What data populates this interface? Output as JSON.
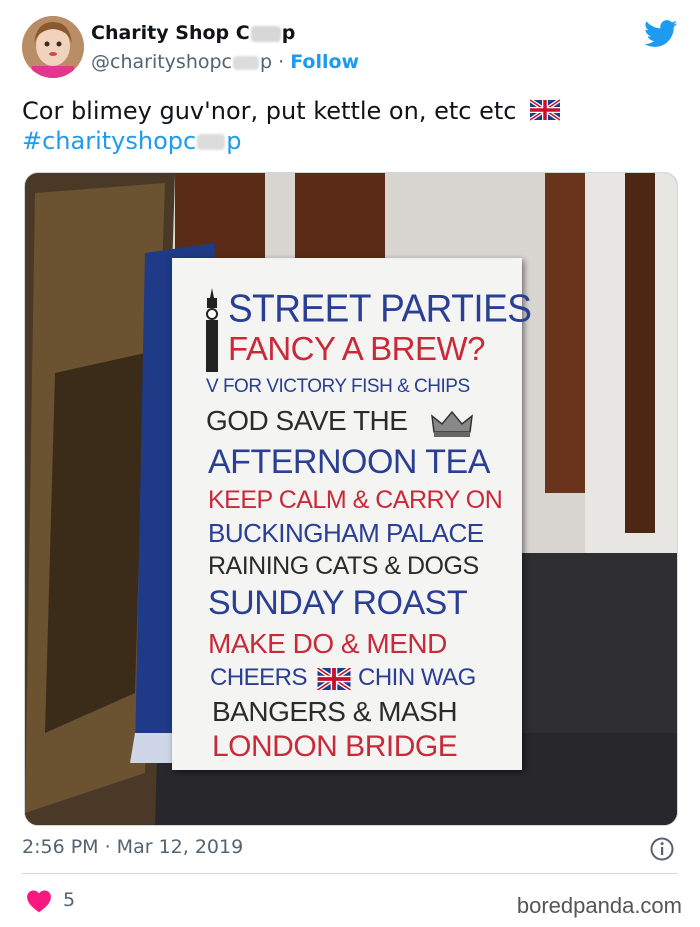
{
  "tweet": {
    "display_name_start": "Charity Shop C",
    "display_name_end": "p",
    "handle_start": "@charityshopc",
    "handle_end": "p",
    "separator": "·",
    "follow_label": "Follow",
    "text": "Cor blimey guv'nor, put kettle on, etc etc",
    "hashtag_start": "#charityshopc",
    "hashtag_end": "p",
    "timestamp": "2:56 PM · Mar 12, 2019",
    "like_count": "5"
  },
  "sign": {
    "lines": [
      "STREET PARTIES",
      "FANCY A BREW?",
      "V FOR VICTORY  FISH & CHIPS",
      "GOD SAVE THE",
      "AFTERNOON TEA",
      "KEEP CALM & CARRY ON",
      "BUCKINGHAM PALACE",
      "RAINING CATS & DOGS",
      "SUNDAY ROAST",
      "MAKE DO & MEND",
      "CHEERS",
      "CHIN WAG",
      "BANGERS & MASH",
      "LONDON BRIDGE"
    ]
  },
  "watermark": "boredpanda.com",
  "colors": {
    "link": "#1d9bf0",
    "like": "#f91880",
    "sign_blue": "#2a3f93",
    "sign_red": "#c92a3a",
    "sign_black": "#2b2b2b"
  },
  "icons": [
    "avatar",
    "twitter-bird-icon",
    "uk-flag-icon",
    "info-icon",
    "heart-icon",
    "big-ben-icon",
    "crown-icon"
  ]
}
